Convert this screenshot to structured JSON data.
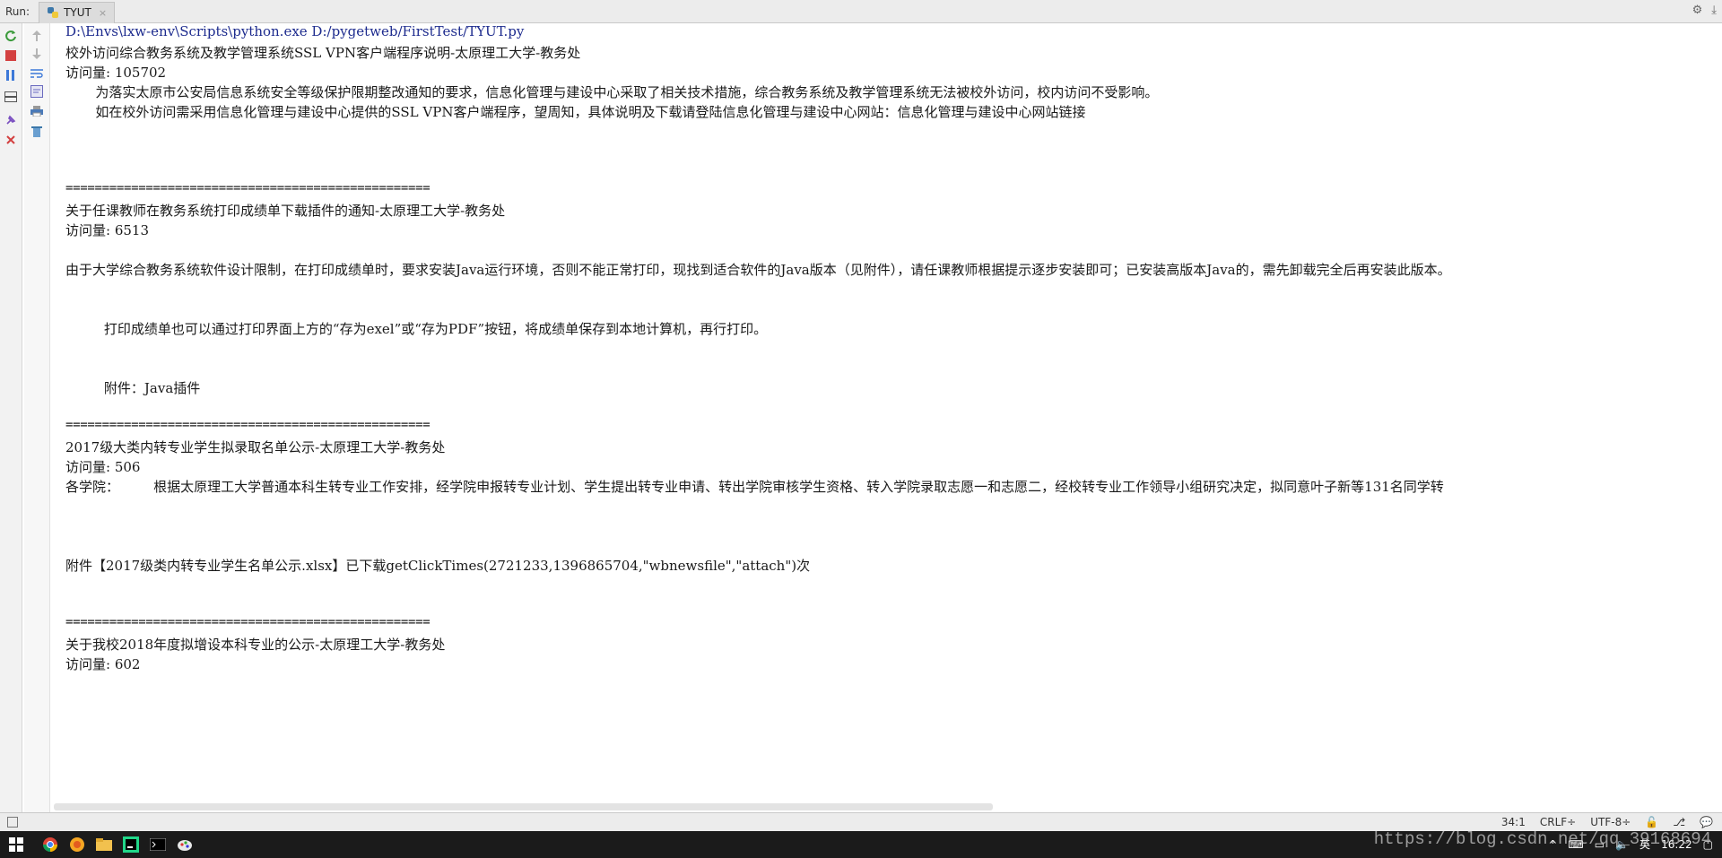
{
  "run_panel": {
    "label": "Run:",
    "tab_name": "TYUT",
    "tab_close": "×"
  },
  "console": {
    "lines": [
      "D:\\Envs\\lxw-env\\Scripts\\python.exe D:/pygetweb/FirstTest/TYUT.py",
      "校外访问综合教务系统及教学管理系统SSL VPN客户端程序说明-太原理工大学-教务处",
      "访问量: 105702",
      "       为落实太原市公安局信息系统安全等级保护限期整改通知的要求，信息化管理与建设中心采取了相关技术措施，综合教务系统及教学管理系统无法被校外访问，校内访问不受影响。",
      "       如在校外访问需采用信息化管理与建设中心提供的SSL VPN客户端程序，望周知，具体说明及下载请登陆信息化管理与建设中心网站：信息化管理与建设中心网站链接",
      "==================================================",
      "关于任课教师在教务系统打印成绩单下载插件的通知-太原理工大学-教务处",
      "访问量: 6513",
      "由于大学综合教务系统软件设计限制，在打印成绩单时，要求安装Java运行环境，否则不能正常打印，现找到适合软件的Java版本（见附件），请任课教师根据提示逐步安装即可；已安装高版本Java的，需先卸载完全后再安装此版本。",
      "         打印成绩单也可以通过打印界面上方的“存为exel”或“存为PDF”按钮，将成绩单保存到本地计算机，再行打印。",
      "         附件：Java插件",
      "==================================================",
      "2017级大类内转专业学生拟录取名单公示-太原理工大学-教务处",
      "访问量: 506",
      "各学院：        根据太原理工大学普通本科生转专业工作安排，经学院申报转专业计划、学生提出转专业申请、转出学院审核学生资格、转入学院录取志愿一和志愿二，经校转专业工作领导小组研究决定，拟同意叶子新等131名同学转",
      "附件【2017级类内转专业学生名单公示.xlsx】已下载getClickTimes(2721233,1396865704,\"wbnewsfile\",\"attach\")次",
      "==================================================",
      "关于我校2018年度拟增设本科专业的公示-太原理工大学-教务处",
      "访问量: 602"
    ]
  },
  "status_bar": {
    "position": "34:1",
    "line_sep": "CRLF÷",
    "encoding": "UTF-8÷"
  },
  "taskbar": {
    "ime": "英",
    "time": "16:22"
  },
  "watermark": "https://blog.csdn.net/qq_39168694"
}
